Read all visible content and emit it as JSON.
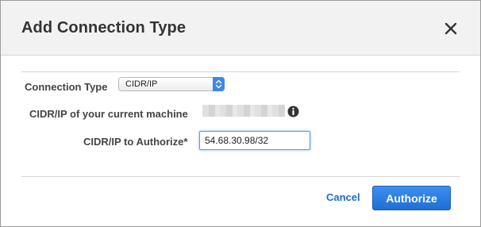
{
  "dialog": {
    "title": "Add Connection Type",
    "close_icon": "close-icon"
  },
  "form": {
    "connection_type_label": "Connection Type",
    "connection_type_value": "CIDR/IP",
    "current_machine_label": "CIDR/IP of your current machine",
    "current_machine_value_redacted": true,
    "info_icon": "info-icon",
    "authorize_label": "CIDR/IP to Authorize*",
    "authorize_value": "54.68.30.98/32"
  },
  "footer": {
    "cancel_label": "Cancel",
    "authorize_label": "Authorize"
  },
  "colors": {
    "accent": "#1f6fd2",
    "link": "#1e6ec8",
    "header_bg": "#f2f2f2"
  }
}
